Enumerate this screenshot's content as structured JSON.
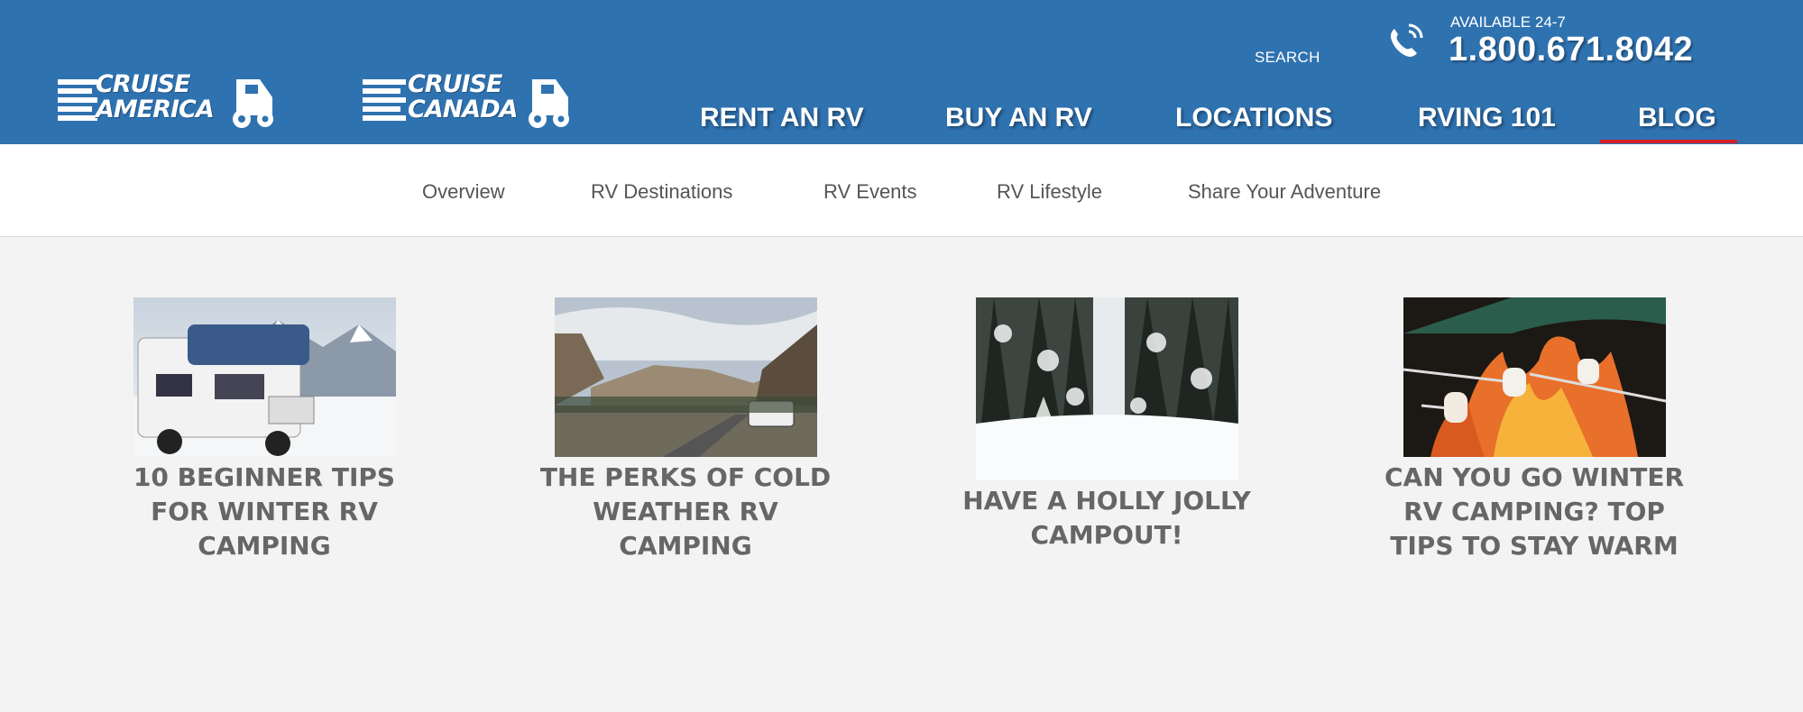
{
  "header": {
    "logos": [
      {
        "name": "cruise-america-logo",
        "line1": "CRUISE",
        "line2": "AMERICA"
      },
      {
        "name": "cruise-canada-logo",
        "line1": "CRUISE",
        "line2": "CANADA"
      }
    ],
    "search_label": "SEARCH",
    "availability": "AVAILABLE 24-7",
    "phone": "1.800.671.8042",
    "nav": [
      "RENT AN RV",
      "BUY AN RV",
      "LOCATIONS",
      "RVING 101",
      "BLOG"
    ],
    "active_nav": "BLOG"
  },
  "subnav": [
    "Overview",
    "RV Destinations",
    "RV Events",
    "RV Lifestyle",
    "Share Your Adventure"
  ],
  "posts": [
    {
      "title": "10 BEGINNER TIPS FOR WINTER RV CAMPING",
      "image": "rv-in-snowy-mountains"
    },
    {
      "title": "THE PERKS OF COLD WEATHER RV CAMPING",
      "image": "rv-on-road-in-valley"
    },
    {
      "title": "HAVE A HOLLY JOLLY CAMPOUT!",
      "image": "snowy-forest-path"
    },
    {
      "title": "CAN YOU GO WINTER RV CAMPING? TOP TIPS TO STAY WARM",
      "image": "marshmallows-over-fire"
    }
  ],
  "colors": {
    "header": "#2f72b0",
    "active_underline": "#d3222a",
    "body_bg": "#f3f3f3"
  }
}
